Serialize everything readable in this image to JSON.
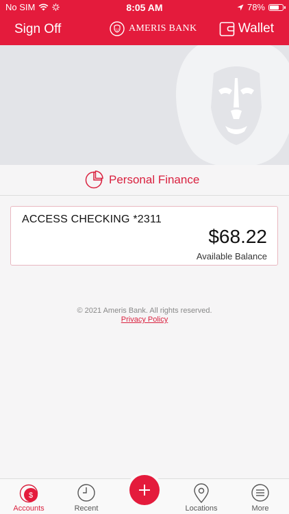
{
  "status_bar": {
    "carrier": "No SIM",
    "time": "8:05 AM",
    "battery_text": "78%",
    "battery_level": 0.78
  },
  "header": {
    "sign_off": "Sign Off",
    "brand_name": "AMERIS BANK",
    "wallet": "Wallet"
  },
  "personal_finance": {
    "label": "Personal Finance"
  },
  "account": {
    "name": "ACCESS CHECKING *2311",
    "balance": "$68.22",
    "balance_label": "Available Balance"
  },
  "footer": {
    "copyright": "© 2021 Ameris Bank. All rights reserved.",
    "privacy": "Privacy Policy"
  },
  "tabs": [
    {
      "label": "Accounts",
      "icon": "accounts-dollar-icon"
    },
    {
      "label": "Recent",
      "icon": "clock-icon"
    },
    {
      "label": "",
      "icon": "plus-icon"
    },
    {
      "label": "Locations",
      "icon": "map-pin-icon"
    },
    {
      "label": "More",
      "icon": "menu-icon"
    }
  ],
  "colors": {
    "brand_red": "#e41b3c",
    "background": "#f6f5f6",
    "banner": "#e3e4e8"
  }
}
